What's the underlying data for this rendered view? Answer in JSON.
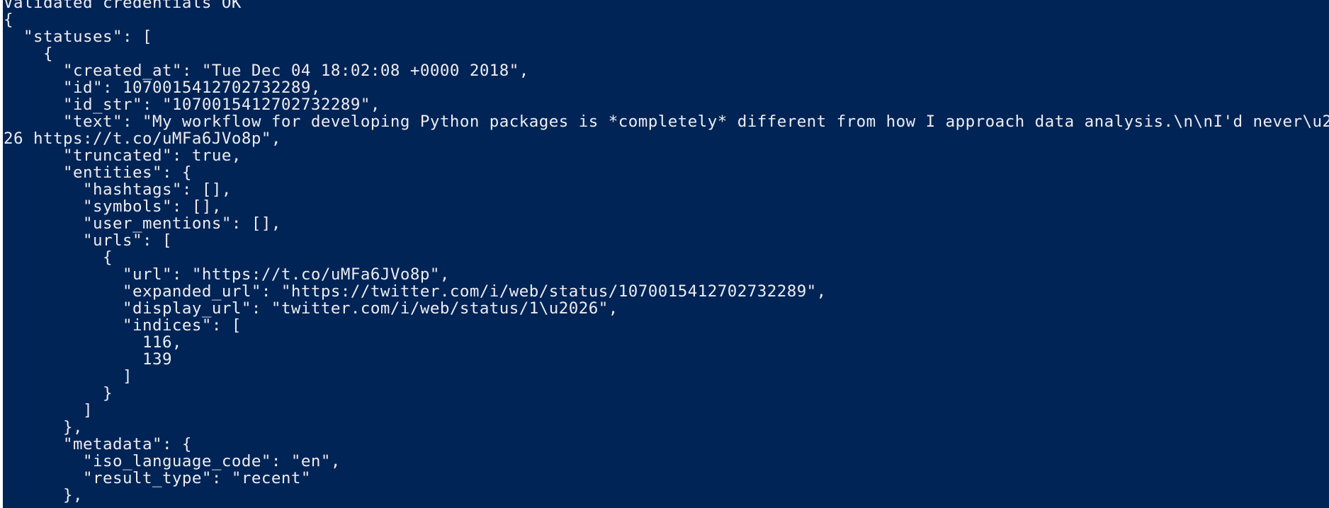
{
  "console": {
    "background": "#012456",
    "foreground": "#eeedf0",
    "lines": [
      "Validated credentials OK",
      "{",
      "  \"statuses\": [",
      "    {",
      "      \"created_at\": \"Tue Dec 04 18:02:08 +0000 2018\",",
      "      \"id\": 1070015412702732289,",
      "      \"id_str\": \"1070015412702732289\",",
      "      \"text\": \"My workflow for developing Python packages is *completely* different from how I approach data analysis.\\n\\nI'd never\\u2",
      "26 https://t.co/uMFa6JVo8p\",",
      "      \"truncated\": true,",
      "      \"entities\": {",
      "        \"hashtags\": [],",
      "        \"symbols\": [],",
      "        \"user_mentions\": [],",
      "        \"urls\": [",
      "          {",
      "            \"url\": \"https://t.co/uMFa6JVo8p\",",
      "            \"expanded_url\": \"https://twitter.com/i/web/status/1070015412702732289\",",
      "            \"display_url\": \"twitter.com/i/web/status/1\\u2026\",",
      "            \"indices\": [",
      "              116,",
      "              139",
      "            ]",
      "          }",
      "        ]",
      "      },",
      "      \"metadata\": {",
      "        \"iso_language_code\": \"en\",",
      "        \"result_type\": \"recent\"",
      "      },"
    ]
  }
}
